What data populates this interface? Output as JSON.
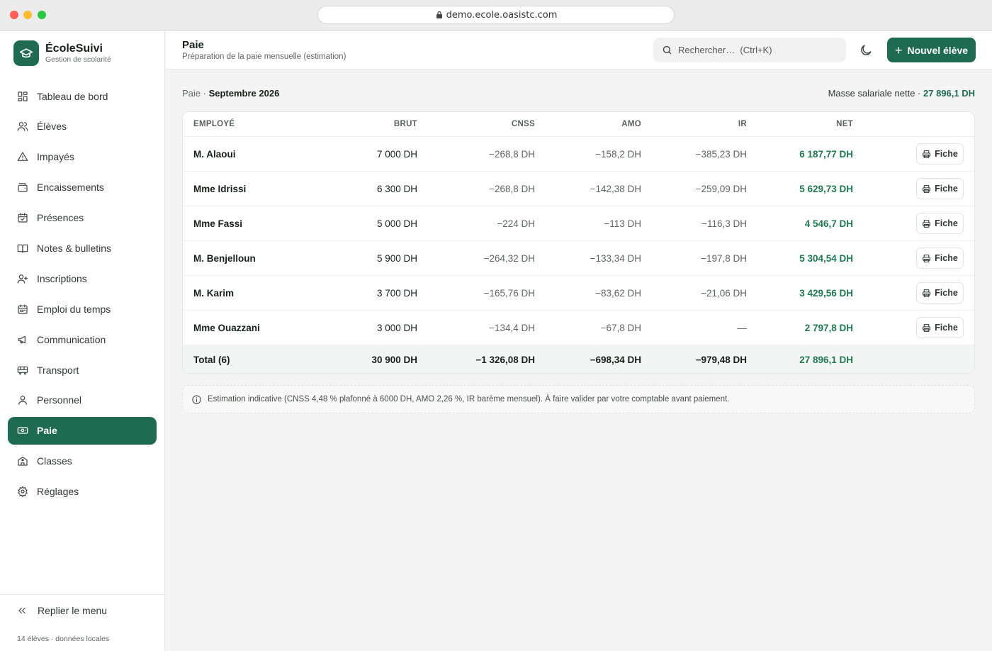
{
  "browser": {
    "url": "demo.ecole.oasistc.com"
  },
  "brand": {
    "name": "ÉcoleSuivi",
    "subtitle": "Gestion de scolarité"
  },
  "sidebar": {
    "items": [
      {
        "label": "Tableau de bord",
        "icon": "dashboard-icon"
      },
      {
        "label": "Élèves",
        "icon": "users-icon"
      },
      {
        "label": "Impayés",
        "icon": "warning-icon"
      },
      {
        "label": "Encaissements",
        "icon": "wallet-icon"
      },
      {
        "label": "Présences",
        "icon": "calendar-check-icon"
      },
      {
        "label": "Notes & bulletins",
        "icon": "book-icon"
      },
      {
        "label": "Inscriptions",
        "icon": "user-plus-icon"
      },
      {
        "label": "Emploi du temps",
        "icon": "calendar-icon"
      },
      {
        "label": "Communication",
        "icon": "megaphone-icon"
      },
      {
        "label": "Transport",
        "icon": "bus-icon"
      },
      {
        "label": "Personnel",
        "icon": "user-icon"
      },
      {
        "label": "Paie",
        "icon": "banknote-icon",
        "active": true
      },
      {
        "label": "Classes",
        "icon": "school-icon"
      },
      {
        "label": "Réglages",
        "icon": "gear-icon"
      }
    ],
    "collapse_label": "Replier le menu",
    "footer_note": "14 élèves · données locales"
  },
  "header": {
    "title": "Paie",
    "subtitle": "Préparation de la paie mensuelle (estimation)",
    "search_placeholder": "Rechercher…  (Ctrl+K)",
    "new_button": "Nouvel élève"
  },
  "breadcrumb": {
    "root": "Paie",
    "separator": " · ",
    "current": "Septembre 2026"
  },
  "summary": {
    "label": "Masse salariale nette · ",
    "value": "27 896,1 DH"
  },
  "table": {
    "columns": {
      "employee": "EMPLOYÉ",
      "brut": "BRUT",
      "cnss": "CNSS",
      "amo": "AMO",
      "ir": "IR",
      "net": "NET"
    },
    "action_label": "Fiche",
    "rows": [
      {
        "employee": "M. Alaoui",
        "brut": "7 000 DH",
        "cnss": "−268,8 DH",
        "amo": "−158,2 DH",
        "ir": "−385,23 DH",
        "net": "6 187,77 DH"
      },
      {
        "employee": "Mme Idrissi",
        "brut": "6 300 DH",
        "cnss": "−268,8 DH",
        "amo": "−142,38 DH",
        "ir": "−259,09 DH",
        "net": "5 629,73 DH"
      },
      {
        "employee": "Mme Fassi",
        "brut": "5 000 DH",
        "cnss": "−224 DH",
        "amo": "−113 DH",
        "ir": "−116,3 DH",
        "net": "4 546,7 DH"
      },
      {
        "employee": "M. Benjelloun",
        "brut": "5 900 DH",
        "cnss": "−264,32 DH",
        "amo": "−133,34 DH",
        "ir": "−197,8 DH",
        "net": "5 304,54 DH"
      },
      {
        "employee": "M. Karim",
        "brut": "3 700 DH",
        "cnss": "−165,76 DH",
        "amo": "−83,62 DH",
        "ir": "−21,06 DH",
        "net": "3 429,56 DH"
      },
      {
        "employee": "Mme Ouazzani",
        "brut": "3 000 DH",
        "cnss": "−134,4 DH",
        "amo": "−67,8 DH",
        "ir": "—",
        "net": "2 797,8 DH"
      }
    ],
    "total": {
      "employee": "Total (6)",
      "brut": "30 900 DH",
      "cnss": "−1 326,08 DH",
      "amo": "−698,34 DH",
      "ir": "−979,48 DH",
      "net": "27 896,1 DH"
    }
  },
  "notice": {
    "text": "Estimation indicative (CNSS 4,48 % plafonné à 6000 DH, AMO 2,26 %, IR barème mensuel). À faire valider par votre comptable avant paiement."
  },
  "colors": {
    "accent": "#1f6b52",
    "net_green": "#1f7a4f"
  }
}
